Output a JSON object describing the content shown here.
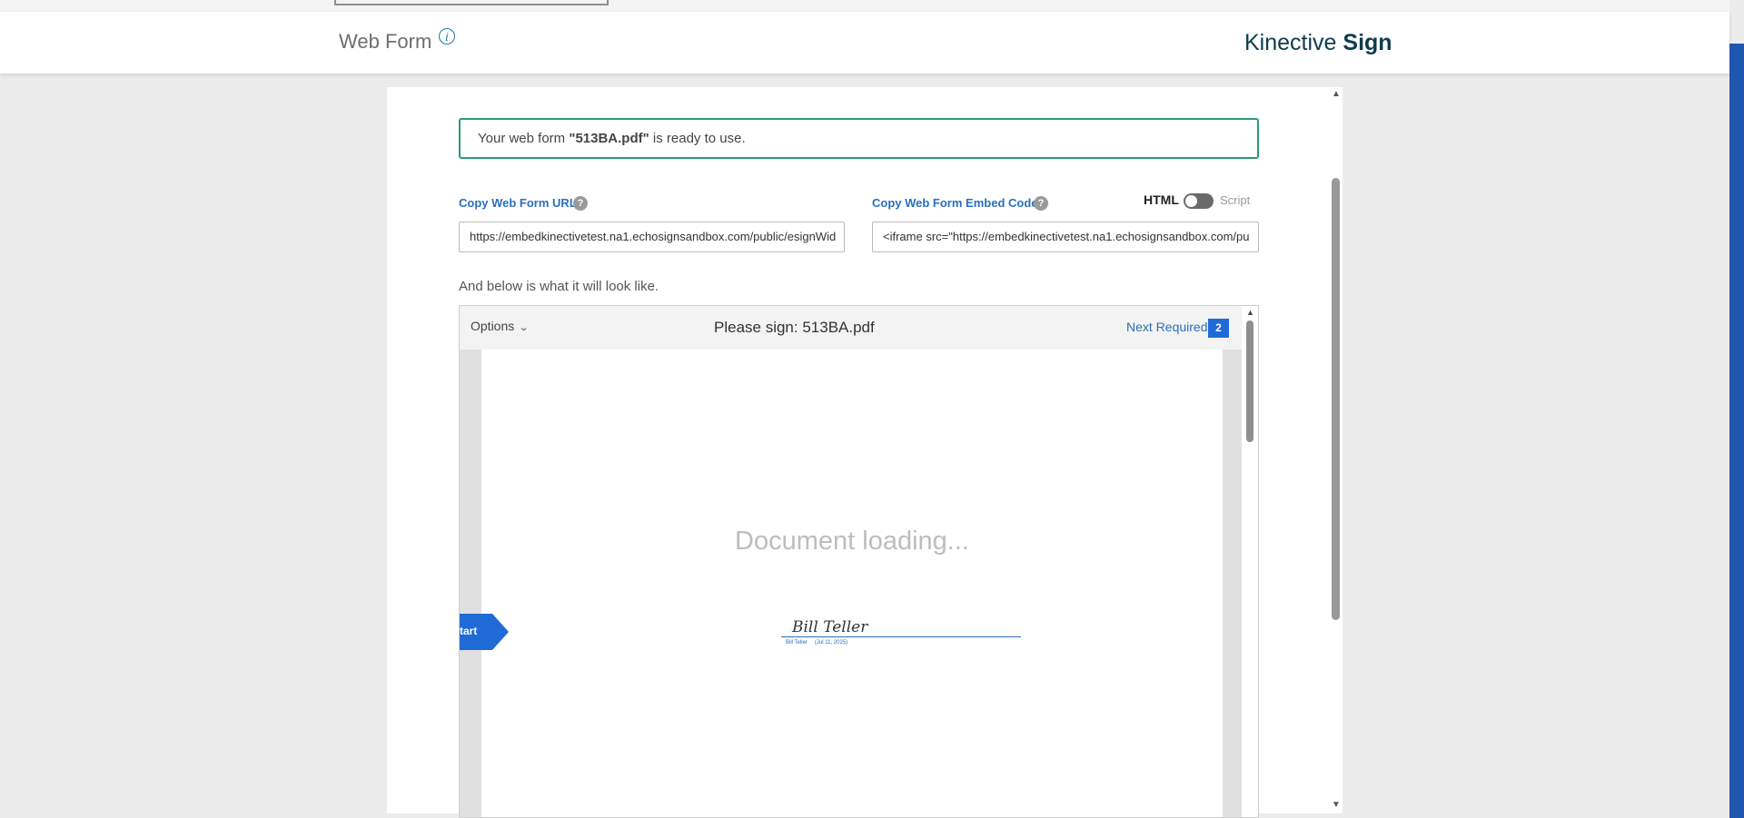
{
  "header": {
    "title": "Web Form",
    "info_icon": "info-icon",
    "brand_light": "Kinective",
    "brand_bold": "Sign"
  },
  "banner": {
    "prefix": "Your web form ",
    "file": "\"513BA.pdf\"",
    "suffix": " is ready to use."
  },
  "url_field": {
    "label": "Copy Web Form URL",
    "help": "?",
    "value": "https://embedkinectivetest.na1.echosignsandbox.com/public/esignWid"
  },
  "embed_field": {
    "label": "Copy Web Form Embed Code",
    "help": "?",
    "value": "<iframe src=\"https://embedkinectivetest.na1.echosignsandbox.com/pu",
    "toggle_left": "HTML",
    "toggle_right": "Script",
    "toggle_on": false
  },
  "preview": {
    "caption": "And below is what it will look like.",
    "options_label": "Options",
    "options_icon": "chevron-down-icon",
    "title": "Please sign: 513BA.pdf",
    "next_required_label": "Next Required",
    "next_required_count": "2",
    "loading_text": "Document loading...",
    "signature_name": "Bill Teller",
    "signature_caption_name": "Bill Teller",
    "signature_caption_date": "(Jul 11, 2025)",
    "start_label": "tart"
  },
  "colors": {
    "accent_blue": "#1f6ad6",
    "link_blue": "#2a6fbd",
    "success_green": "#2d9a6c",
    "brand_dark": "#0e3c4e"
  }
}
